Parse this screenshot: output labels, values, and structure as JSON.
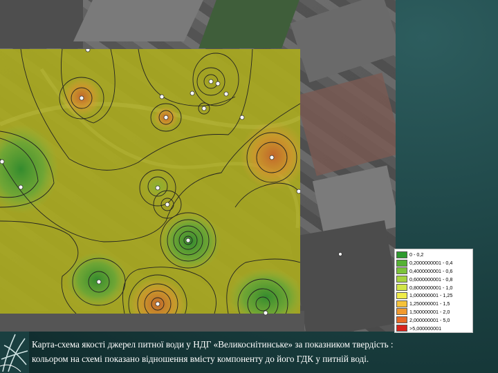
{
  "legend": {
    "items": [
      {
        "label": "0 - 0,2",
        "color": "#2e9a2e"
      },
      {
        "label": "0,2000000001 - 0,4",
        "color": "#55b233"
      },
      {
        "label": "0,4000000001 - 0,6",
        "color": "#7cc43a"
      },
      {
        "label": "0,6000000001 - 0,8",
        "color": "#a6d43f"
      },
      {
        "label": "0,8000000001 - 1,0",
        "color": "#d2e649"
      },
      {
        "label": "1,000000001 - 1,25",
        "color": "#f0ec4a"
      },
      {
        "label": "1,250000001 - 1,5",
        "color": "#f5c23a"
      },
      {
        "label": "1,500000001 - 2,0",
        "color": "#f29a2e"
      },
      {
        "label": "2,000000001 - 5,0",
        "color": "#e86a26"
      },
      {
        "label": ">5,000000001",
        "color": "#d8231c"
      }
    ]
  },
  "caption": {
    "line1": "Карта-схема якості джерел питної води у НДГ «Великоснітинське» за показником твердість :",
    "line2": "кольором на схемі показано відношення вмісту компоненту до його ГДК у питній воді."
  },
  "colors": {
    "overlay_base": "#a9a91f",
    "background": "#1f4a4a"
  }
}
